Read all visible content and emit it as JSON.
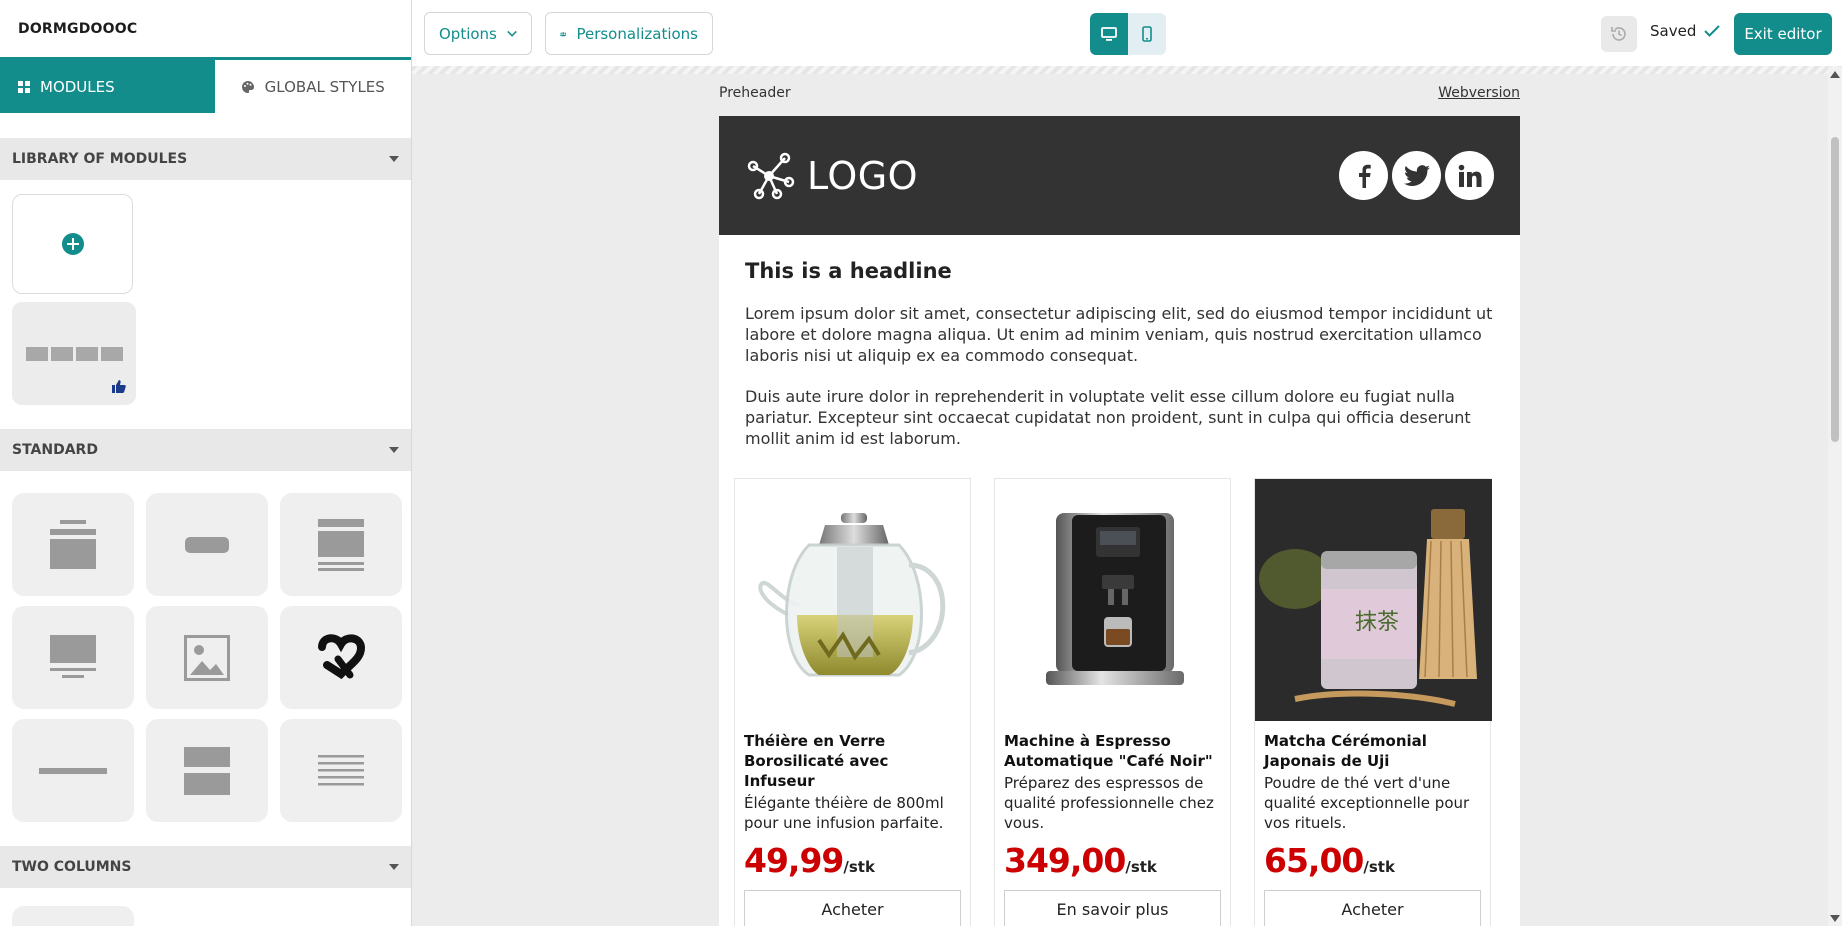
{
  "sidebar": {
    "title": "DORMGDOOOC",
    "tabs": [
      {
        "label": "MODULES",
        "active": true,
        "icon": "grid-icon"
      },
      {
        "label": "GLOBAL STYLES",
        "active": false,
        "icon": "palette-icon"
      }
    ],
    "sections": {
      "library": "LIBRARY OF MODULES",
      "standard": "STANDARD",
      "two_columns": "TWO COLUMNS"
    },
    "standard_modules": [
      "header-block-module",
      "button-module",
      "text-image-module",
      "image-text-module",
      "image-module",
      "heart-brand-module",
      "divider-module",
      "two-rows-module",
      "text-module"
    ]
  },
  "topbar": {
    "options_label": "Options",
    "personalizations_label": "Personalizations",
    "saved_label": "Saved",
    "exit_label": "Exit editor"
  },
  "email": {
    "preheader": "Preheader",
    "webversion": "Webversion",
    "logo_text": "LOGO",
    "headline": "This is a headline",
    "paragraphs": [
      "Lorem ipsum dolor sit amet, consectetur adipiscing elit, sed do eiusmod tempor incididunt ut labore et dolore magna aliqua. Ut enim ad minim veniam, quis nostrud exercitation ullamco laboris nisi ut aliquip ex ea commodo consequat.",
      "Duis aute irure dolor in reprehenderit in voluptate velit esse cillum dolore eu fugiat nulla pariatur. Excepteur sint occaecat cupidatat non proident, sunt in culpa qui officia deserunt mollit anim id est laborum."
    ],
    "products": [
      {
        "title": "Théière en Verre Borosilicaté avec Infuseur",
        "desc": "Élégante théière de 800ml pour une infusion parfaite.",
        "price": "49,99",
        "unit": "/stk",
        "button": "Acheter"
      },
      {
        "title": "Machine à Espresso Automatique \"Café Noir\"",
        "desc": "Préparez des espressos de qualité professionnelle chez vous.",
        "price": "349,00",
        "unit": "/stk",
        "button": "En savoir plus"
      },
      {
        "title": "Matcha Cérémonial Japonais de Uji",
        "desc": "Poudre de thé vert d'une qualité exceptionnelle pour vos rituels.",
        "price": "65,00",
        "unit": "/stk",
        "button": "Acheter"
      }
    ]
  },
  "colors": {
    "accent": "#128d8c",
    "header_dark": "#333333",
    "price_red": "#cc0000"
  }
}
